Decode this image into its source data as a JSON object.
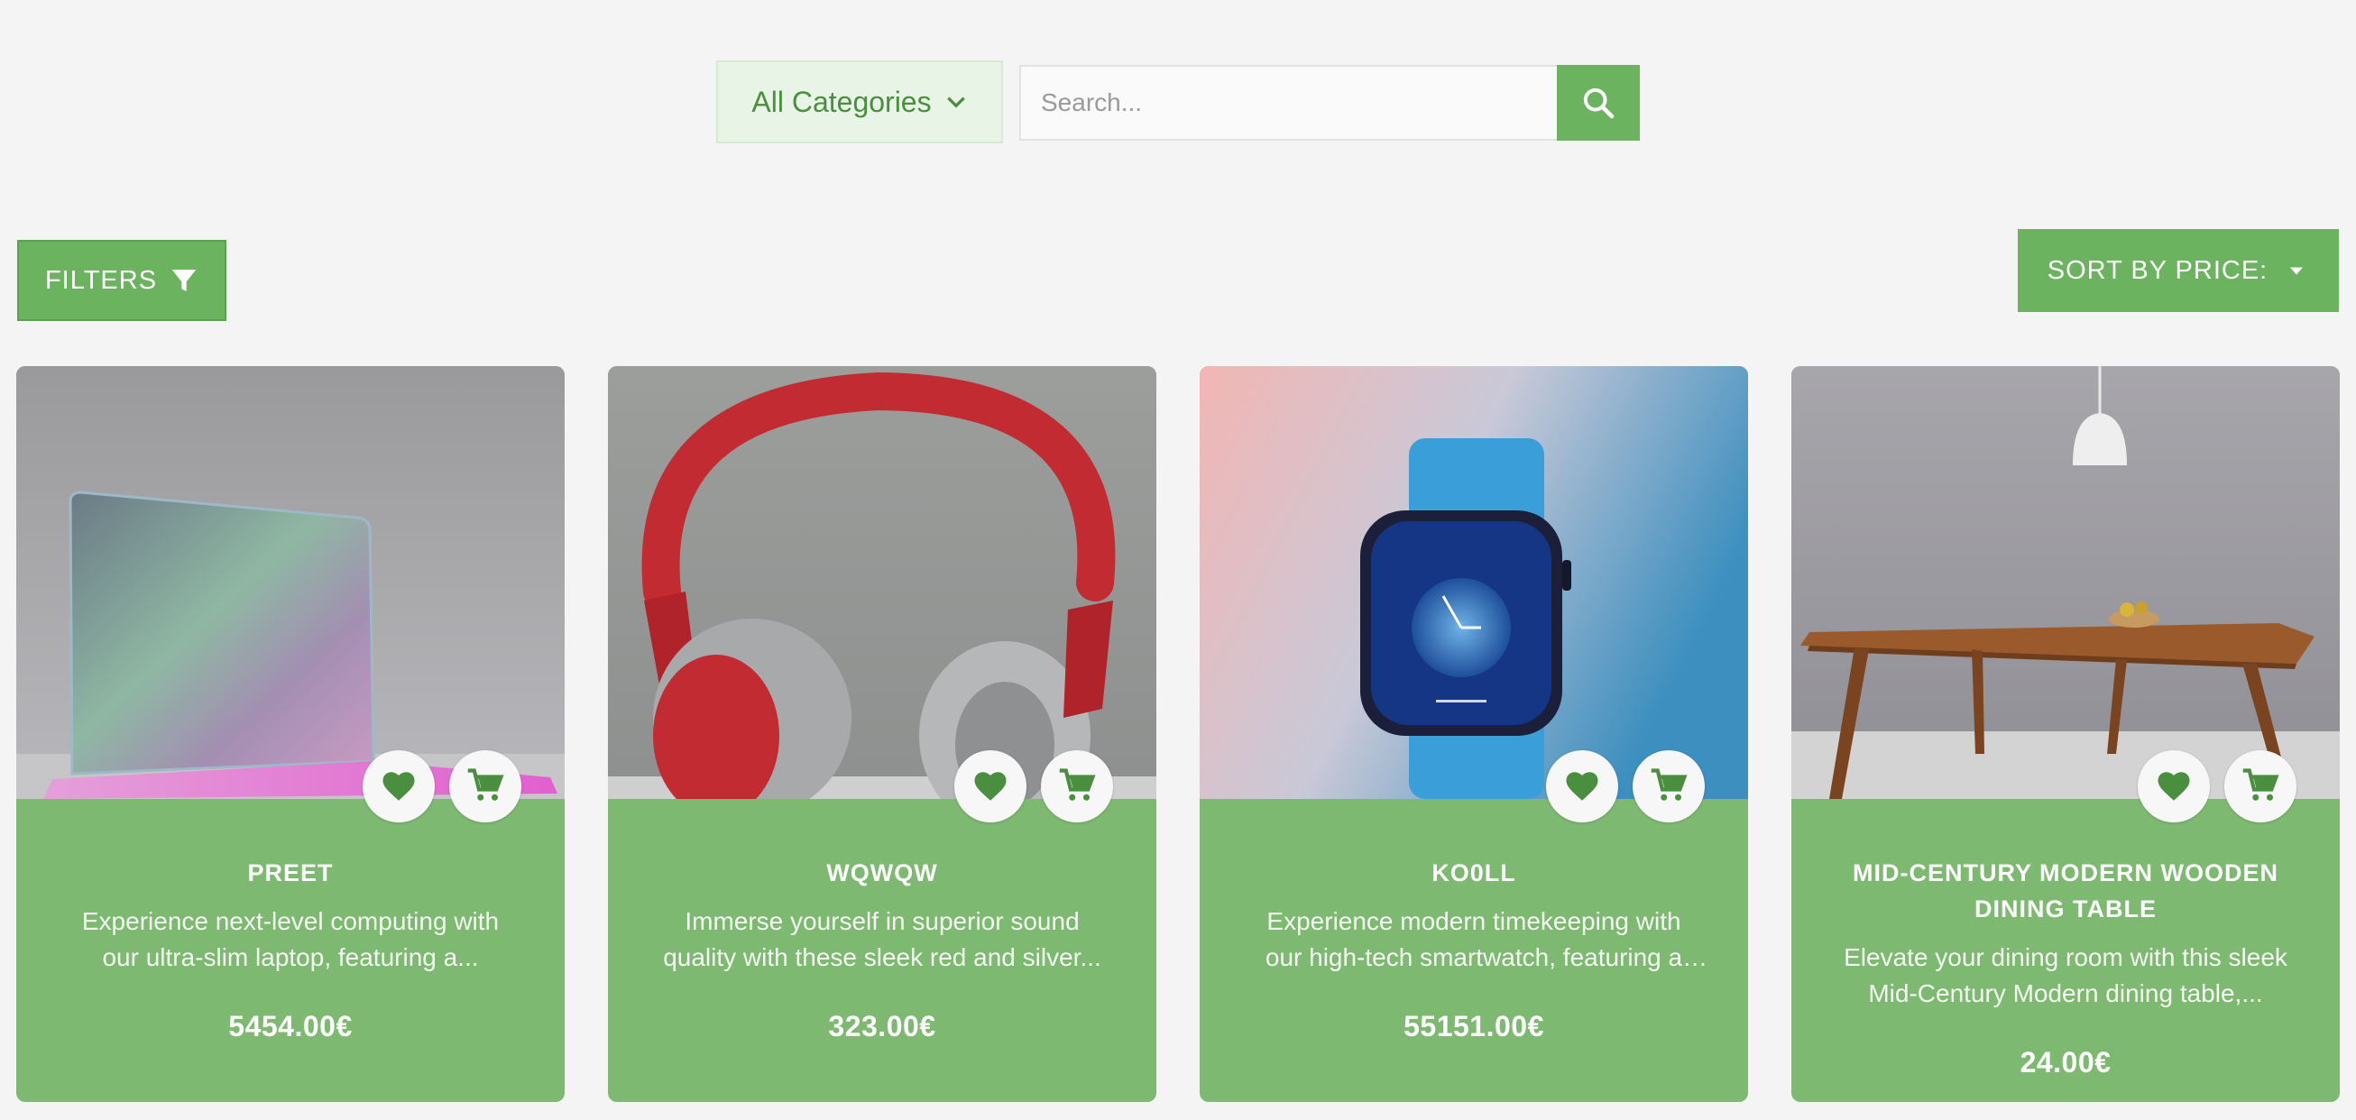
{
  "search": {
    "category_label": "All Categories",
    "placeholder": "Search..."
  },
  "toolbar": {
    "filters_label": "FILTERS",
    "sort_label": "SORT BY PRICE:"
  },
  "colors": {
    "accent": "#6cb35f",
    "card": "#7eb972",
    "icon": "#4a8f3f"
  },
  "products": [
    {
      "name": "PREET",
      "description": "Experience next-level computing with our ultra-slim laptop, featuring a...",
      "price": "5454.00€",
      "image": "laptop"
    },
    {
      "name": "WQWQW",
      "description": "Immerse yourself in superior sound quality with these sleek red and silver...",
      "price": "323.00€",
      "image": "headphones"
    },
    {
      "name": "KO0LL",
      "description": "Experience modern timekeeping with our high-tech smartwatch, featuring a vivid..",
      "price": "55151.00€",
      "image": "smartwatch"
    },
    {
      "name": "MID-CENTURY MODERN WOODEN DINING TABLE",
      "description": "Elevate your dining room with this sleek Mid-Century Modern dining table,...",
      "price": "24.00€",
      "image": "dining-table"
    }
  ]
}
